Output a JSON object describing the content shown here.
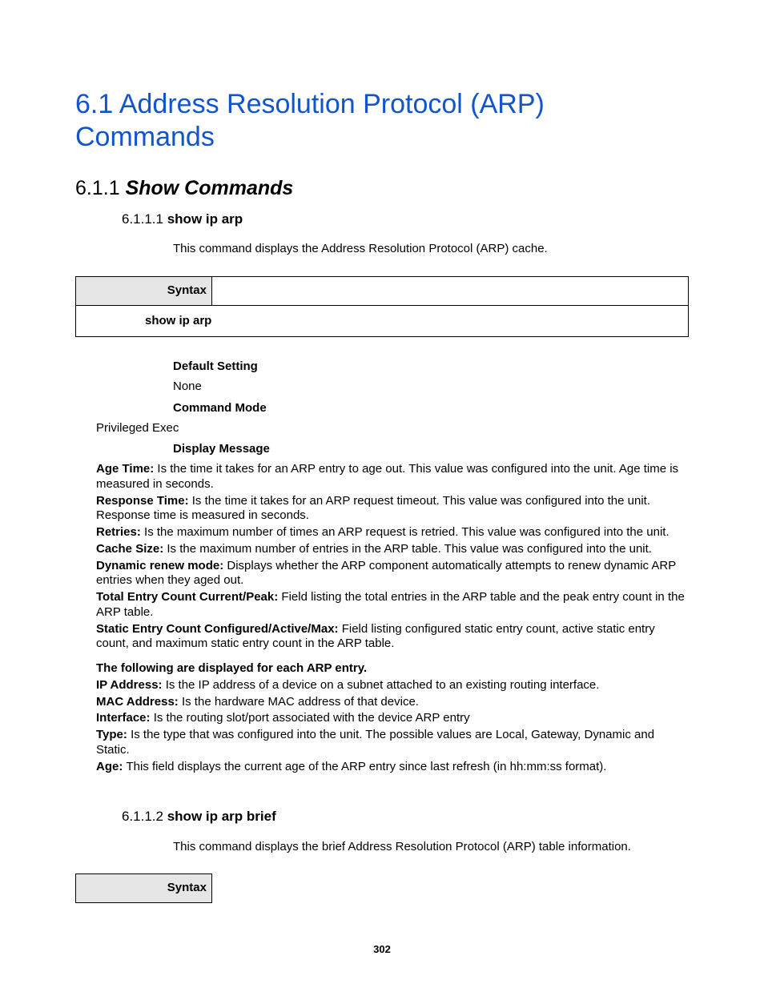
{
  "h1": "6.1 Address Resolution Protocol (ARP) Commands",
  "h2_num": "6.1.1 ",
  "h2_title": "Show Commands",
  "s1": {
    "num": "6.1.1.1 ",
    "title": "show ip arp",
    "desc": "This command displays the Address Resolution Protocol (ARP) cache.",
    "syntax_label": "Syntax",
    "syntax_body": "show ip arp",
    "default_label": "Default Setting",
    "default_value": "None",
    "mode_label": "Command Mode",
    "mode_value": "Privileged Exec",
    "display_label": "Display Message",
    "msgs": [
      {
        "term": "Age Time: ",
        "text": "Is the time it takes for an ARP entry to age out. This value was configured into the unit. Age time is measured in seconds."
      },
      {
        "term": "Response Time: ",
        "text": "Is the time it takes for an ARP request timeout. This value was configured into the unit. Response time is measured in seconds."
      },
      {
        "term": "Retries: ",
        "text": "Is the maximum number of times an ARP request is retried. This value was configured into the unit."
      },
      {
        "term": "Cache Size: ",
        "text": "Is the maximum number of entries in the ARP table. This value was configured into the unit."
      },
      {
        "term": "Dynamic renew mode: ",
        "text": "Displays whether the ARP component automatically attempts to renew dynamic ARP entries when they aged out."
      },
      {
        "term": "Total Entry Count Current/Peak: ",
        "text": "Field listing the total entries in the ARP table and the peak entry count in the ARP table."
      },
      {
        "term": "Static Entry Count Configured/Active/Max: ",
        "text": "Field listing configured static entry count, active static entry count, and maximum static entry count in the ARP table."
      }
    ],
    "per_entry_intro": "The following are displayed for each ARP entry.",
    "per_entry": [
      {
        "term": "IP Address: ",
        "text": "Is the IP address of a device on a subnet attached to an existing routing interface."
      },
      {
        "term": "MAC Address: ",
        "text": "Is the hardware MAC address of that device."
      },
      {
        "term": "Interface: ",
        "text": "Is the routing slot/port associated with the device ARP entry"
      },
      {
        "term": "Type: ",
        "text": "Is the type that was configured into the unit. The possible values are Local, Gateway, Dynamic and Static."
      },
      {
        "term": "Age: ",
        "text": "This field displays the current age of the ARP entry since last refresh (in hh:mm:ss format)."
      }
    ]
  },
  "s2": {
    "num": "6.1.1.2 ",
    "title": "show ip arp brief",
    "desc": "This command displays the brief Address Resolution Protocol (ARP) table information.",
    "syntax_label": "Syntax"
  },
  "page_num": "302"
}
